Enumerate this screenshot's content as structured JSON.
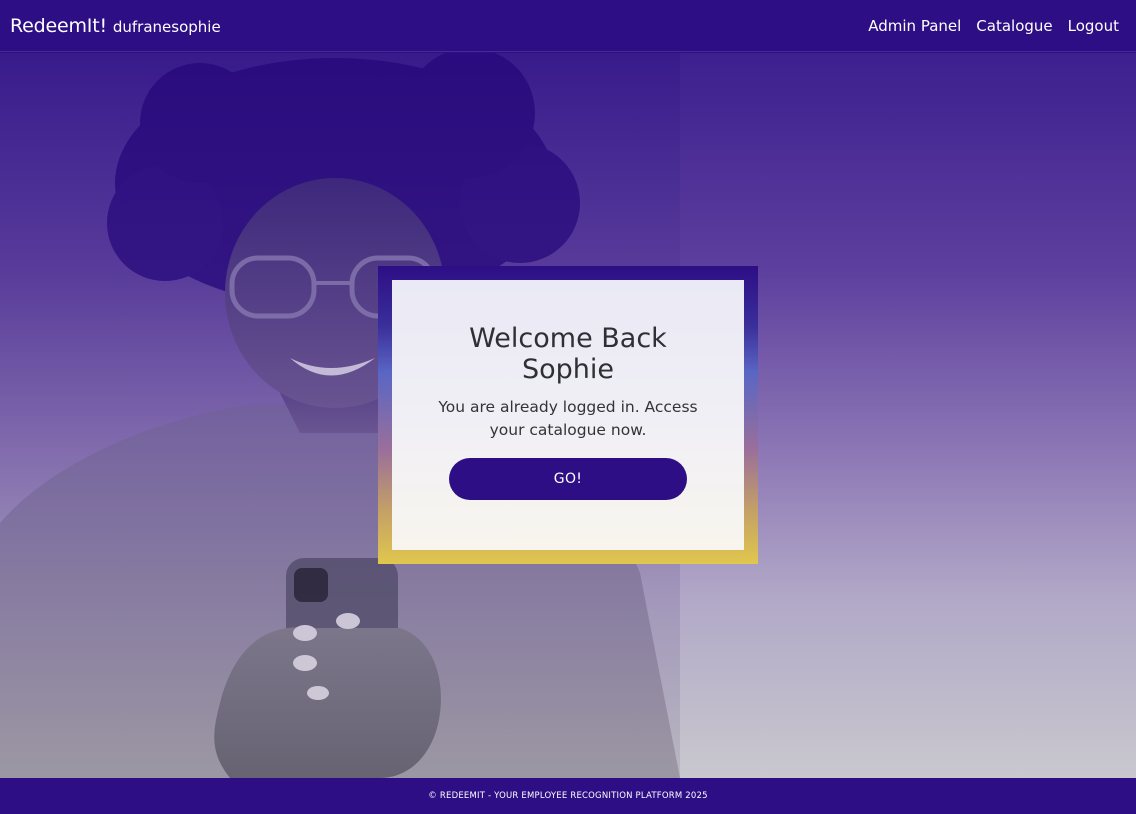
{
  "navbar": {
    "brand": "RedeemIt!",
    "username": "dufranesophie",
    "links": [
      "Admin Panel",
      "Catalogue",
      "Logout"
    ]
  },
  "welcome_card": {
    "title": "Welcome Back Sophie",
    "message": "You are already logged in. Access your catalogue now.",
    "button_label": "GO!"
  },
  "footer": {
    "text": "© REDEEMIT - YOUR EMPLOYEE RECOGNITION PLATFORM 2025"
  },
  "colors": {
    "brand_primary": "#2d0e85",
    "frame_gold": "#e0c74e",
    "card_background": "#f0eff5"
  },
  "icons": {
    "hero_image": "woman-with-smartphone-photo"
  }
}
